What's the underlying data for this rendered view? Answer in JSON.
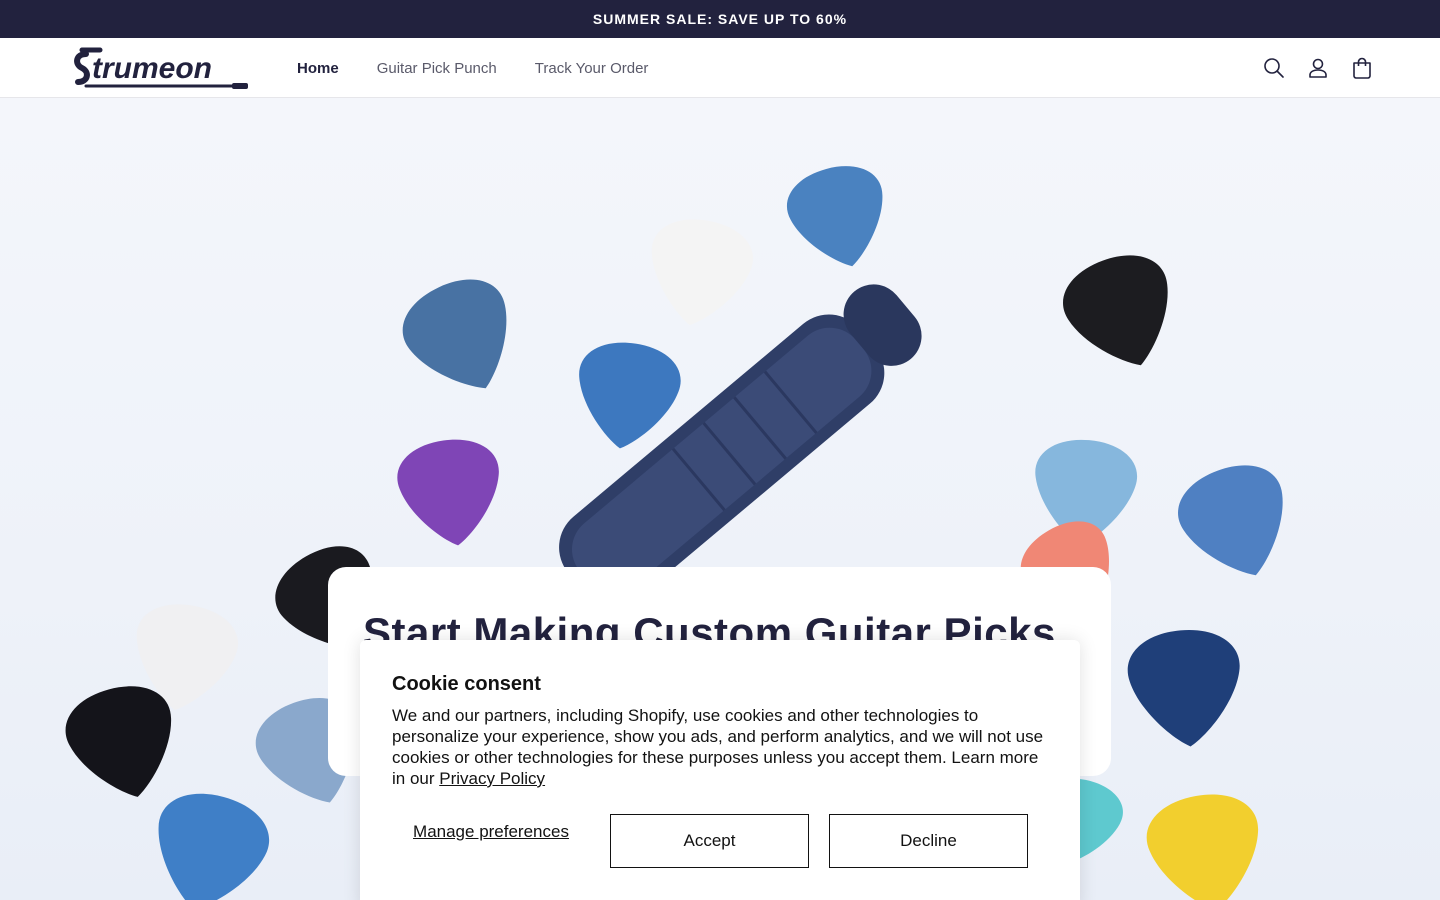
{
  "announcement": {
    "text": "SUMMER SALE: SAVE UP TO 60%"
  },
  "header": {
    "logo_text": "Strumeon",
    "nav": [
      {
        "label": "Home",
        "active": true
      },
      {
        "label": "Guitar Pick Punch",
        "active": false
      },
      {
        "label": "Track Your Order",
        "active": false
      }
    ],
    "icons": [
      "search-icon",
      "account-icon",
      "cart-icon"
    ]
  },
  "hero": {
    "title": "Start Making Custom Guitar Picks"
  },
  "cookie": {
    "title": "Cookie consent",
    "body": "We and our partners, including Shopify, use cookies and other technologies to personalize your experience, show you ads, and perform analytics, and we will not use cookies or other technologies for these purposes unless you accept them. Learn more in our ",
    "privacy_link": "Privacy Policy",
    "manage_label": "Manage preferences",
    "accept_label": "Accept",
    "decline_label": "Decline"
  },
  "colors": {
    "brand_navy": "#22223e",
    "text": "#121212",
    "muted_nav": "#5a5a6a"
  }
}
